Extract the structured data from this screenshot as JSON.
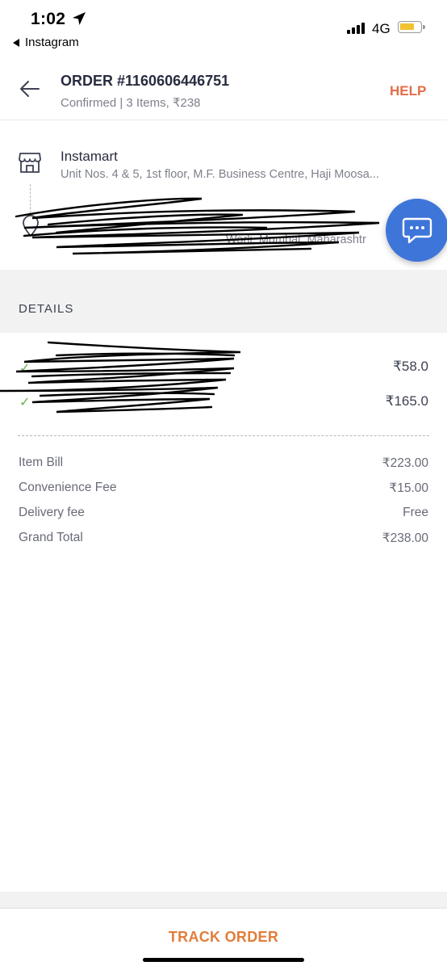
{
  "status_bar": {
    "time": "1:02",
    "back_app": "Instagram",
    "network": "4G",
    "battery_level": 0.6,
    "battery_color": "#f2c230"
  },
  "header": {
    "back_icon": "arrow-left-icon",
    "title": "ORDER #1160606446751",
    "subtitle": "Confirmed | 3 Items, ₹238",
    "help_label": "HELP",
    "help_color": "#e46d47"
  },
  "store": {
    "icon": "store-icon",
    "name": "Instamart",
    "address": "Unit Nos. 4 & 5, 1st floor, M.F. Business Centre, Haji Moosa..."
  },
  "delivery": {
    "icon": "location-pin-icon",
    "name_redacted": true,
    "address_visible_fragment": "Worli, Mumbai, Maharashtr"
  },
  "chat": {
    "icon": "chat-bubble-icon",
    "color": "#3e75d9"
  },
  "details": {
    "section_label": "DETAILS",
    "items": [
      {
        "check_icon": "check-icon",
        "name_redacted": true,
        "price": "₹58.0"
      },
      {
        "check_icon": "check-icon",
        "name_redacted": true,
        "price": "₹165.0"
      }
    ]
  },
  "bill": {
    "rows": [
      {
        "label": "Item Bill",
        "value": "₹223.00"
      },
      {
        "label": "Convenience Fee",
        "value": "₹15.00"
      },
      {
        "label": "Delivery fee",
        "value": "Free"
      },
      {
        "label": "Grand Total",
        "value": "₹238.00"
      }
    ]
  },
  "footer": {
    "track_label": "TRACK ORDER",
    "track_color": "#e27d3b"
  }
}
